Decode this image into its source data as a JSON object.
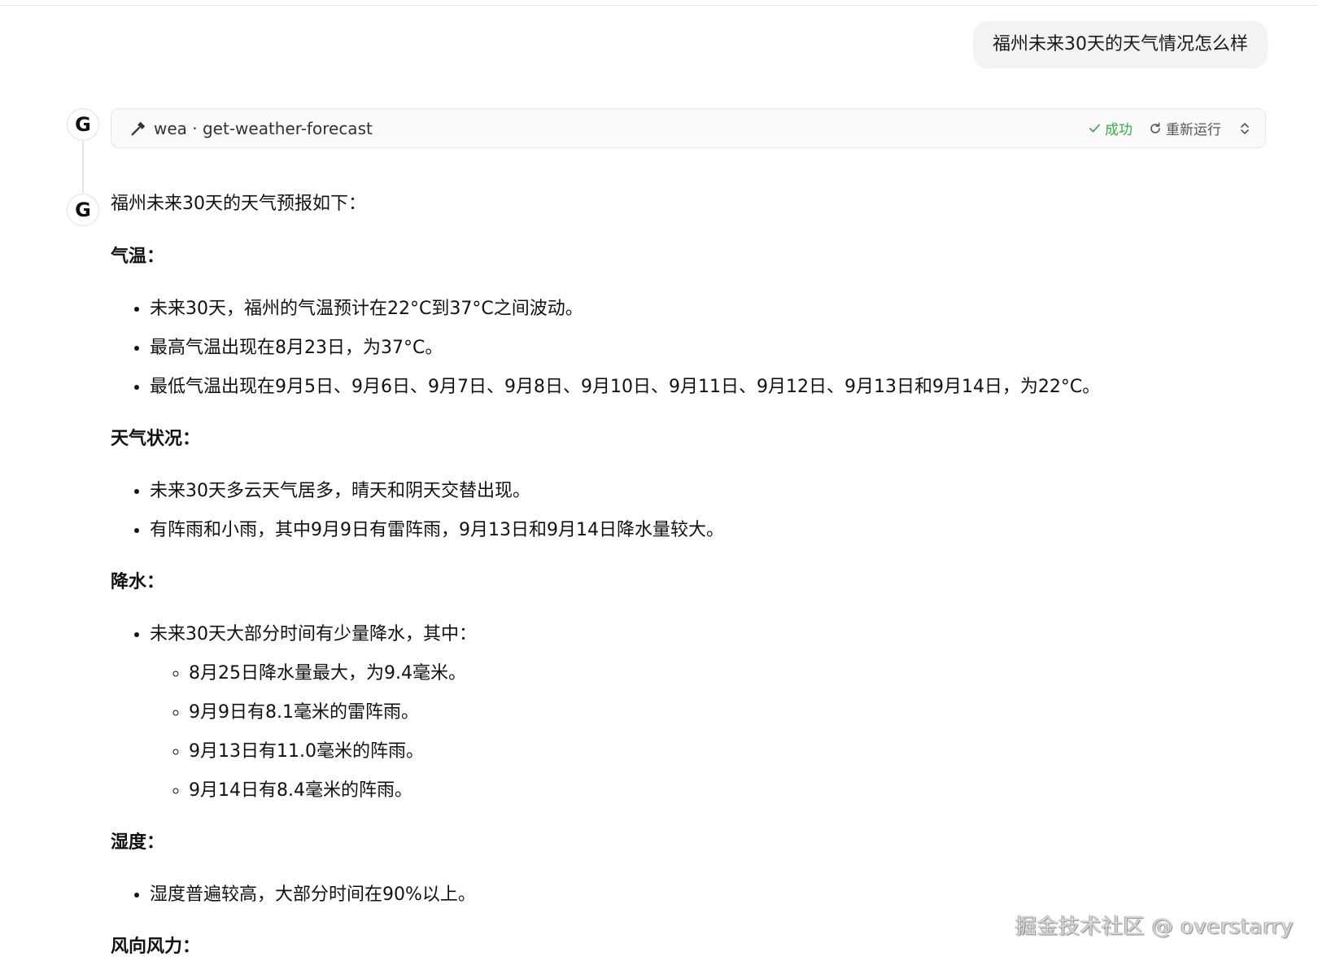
{
  "user_message": "福州未来30天的天气情况怎么样",
  "assistant_avatar_letter": "G",
  "tool_call": {
    "name": "wea · get-weather-forecast",
    "status": "成功",
    "rerun_label": "重新运行",
    "status_color": "#2fb344"
  },
  "response": {
    "intro": "福州未来30天的天气预报如下：",
    "sections": [
      {
        "heading": "气温：",
        "items": [
          "未来30天，福州的气温预计在22°C到37°C之间波动。",
          "最高气温出现在8月23日，为37°C。",
          "最低气温出现在9月5日、9月6日、9月7日、9月8日、9月10日、9月11日、9月12日、9月13日和9月14日，为22°C。"
        ]
      },
      {
        "heading": "天气状况：",
        "items": [
          "未来30天多云天气居多，晴天和阴天交替出现。",
          "有阵雨和小雨，其中9月9日有雷阵雨，9月13日和9月14日降水量较大。"
        ]
      },
      {
        "heading": "降水：",
        "item": "未来30天大部分时间有少量降水，其中：",
        "subitems": [
          "8月25日降水量最大，为9.4毫米。",
          "9月9日有8.1毫米的雷阵雨。",
          "9月13日有11.0毫米的阵雨。",
          "9月14日有8.4毫米的阵雨。"
        ]
      },
      {
        "heading": "湿度：",
        "items": [
          "湿度普遍较高，大部分时间在90%以上。"
        ]
      },
      {
        "heading": "风向风力："
      }
    ]
  },
  "watermark": "掘金技术社区 @ overstarry"
}
